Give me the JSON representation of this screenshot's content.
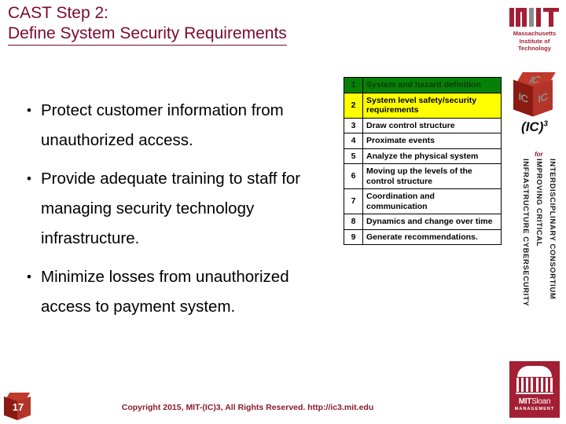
{
  "slide": {
    "title_line1": "CAST Step 2:",
    "title_line2": "Define System Security Requirements",
    "title_color": "#7B0A2E"
  },
  "bullets": [
    {
      "marker": "•",
      "text": "Protect customer information from unauthorized access."
    },
    {
      "marker": "•",
      "text": "Provide adequate training to staff for managing security technology infrastructure."
    },
    {
      "marker": "•",
      "text": "Minimize losses from unauthorized access to payment system."
    }
  ],
  "steps_table": {
    "highlight_green": "#078007",
    "highlight_yellow": "#FFFF00",
    "rows": [
      {
        "num": "1",
        "label": "System and hazard definition",
        "state": "green"
      },
      {
        "num": "2",
        "label": "System level safety/security requirements",
        "state": "yellow"
      },
      {
        "num": "3",
        "label": "Draw control structure",
        "state": "plain"
      },
      {
        "num": "4",
        "label": "Proximate events",
        "state": "plain"
      },
      {
        "num": "5",
        "label": "Analyze the physical system",
        "state": "plain"
      },
      {
        "num": "6",
        "label": "Moving up the levels of the control structure",
        "state": "plain"
      },
      {
        "num": "7",
        "label": "Coordination and communication",
        "state": "plain"
      },
      {
        "num": "8",
        "label": "Dynamics and change over time",
        "state": "plain"
      },
      {
        "num": "9",
        "label": "Generate recommendations.",
        "state": "plain"
      }
    ]
  },
  "logos": {
    "mit": {
      "name_line1": "Massachusetts",
      "name_line2": "Institute of",
      "name_line3": "Technology",
      "color": "#A31F34"
    },
    "ic3": {
      "cube_top": "IC",
      "cube_left": "IC",
      "cube_right": "IC",
      "wordmark": "(IC)",
      "wordmark_sup": "3"
    },
    "consortium": {
      "for": "for",
      "line1": "INTERDISCIPLINARY CONSORTIUM",
      "line2": "IMPROVING CRITICAL",
      "line3": "INFRASTRUCTURE CYBERSECURITY"
    },
    "sloan": {
      "name_bold": "MIT",
      "name_light": "Sloan",
      "subtitle": "MANAGEMENT",
      "color": "#A31F34"
    }
  },
  "footer": {
    "page_number": "17",
    "copyright": "Copyright 2015, MIT-(IC)3, All Rights Reserved. http://ic3.mit.edu"
  }
}
